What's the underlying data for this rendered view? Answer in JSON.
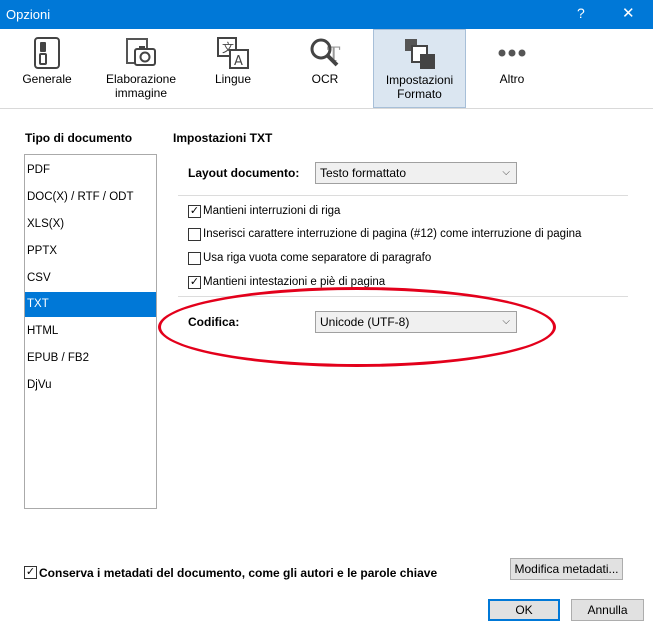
{
  "window": {
    "title": "Opzioni",
    "help_glyph": "?",
    "close_glyph": "✕"
  },
  "toolbar": [
    {
      "label": "Generale",
      "icon": "general-icon"
    },
    {
      "label": "Elaborazione immagine",
      "icon": "image-processing-icon"
    },
    {
      "label": "Lingue",
      "icon": "languages-icon"
    },
    {
      "label": "OCR",
      "icon": "ocr-icon"
    },
    {
      "label": "Impostazioni Formato",
      "icon": "format-settings-icon",
      "active": true
    },
    {
      "label": "Altro",
      "icon": "more-icon"
    }
  ],
  "left": {
    "title": "Tipo di documento",
    "items": [
      "PDF",
      "DOC(X) / RTF / ODT",
      "XLS(X)",
      "PPTX",
      "CSV",
      "TXT",
      "HTML",
      "EPUB / FB2",
      "DjVu"
    ],
    "selected": "TXT"
  },
  "right": {
    "title": "Impostazioni TXT",
    "layout_label": "Layout documento:",
    "layout_value": "Testo formattato",
    "checkboxes": [
      {
        "label": "Mantieni interruzioni di riga",
        "checked": true
      },
      {
        "label": "Inserisci carattere interruzione di pagina (#12) come interruzione di pagina",
        "checked": false
      },
      {
        "label": "Usa riga vuota come separatore di paragrafo",
        "checked": false
      },
      {
        "label": "Mantieni intestazioni e piè di pagina",
        "checked": true
      }
    ],
    "encoding_label": "Codifica:",
    "encoding_value": "Unicode (UTF-8)"
  },
  "footer": {
    "metadata_label": "Conserva i metadati del documento, come gli autori e le parole chiave",
    "metadata_checked": true,
    "edit_metadata_button": "Modifica metadati...",
    "ok_button": "OK",
    "cancel_button": "Annulla"
  },
  "colors": {
    "accent": "#0078d7",
    "selection": "#0078d7",
    "annotation": "#e3001b"
  }
}
